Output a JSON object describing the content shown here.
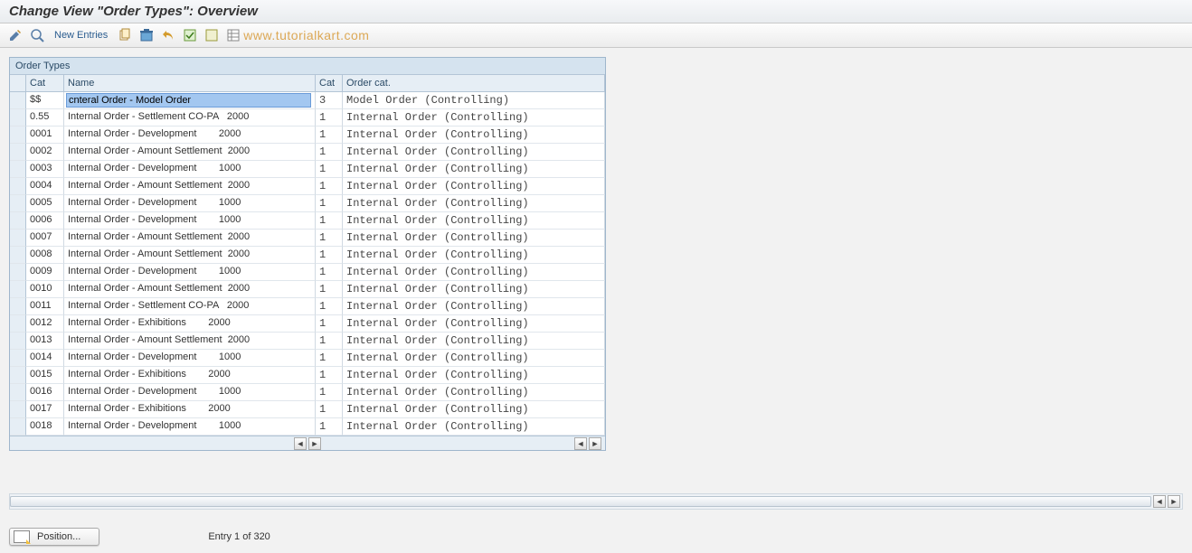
{
  "title": "Change View \"Order Types\": Overview",
  "toolbar": {
    "new_entries": "New Entries"
  },
  "watermark": "www.tutorialkart.com",
  "panel": {
    "title": "Order Types",
    "columns": {
      "selector": "",
      "cat1": "Cat",
      "name": "Name",
      "cat2": "Cat",
      "order_cat": "Order cat."
    }
  },
  "selected_name_value": "cnteral Order - Model Order",
  "rows": [
    {
      "cat1": "$$",
      "name": "cnteral Order - Model Order",
      "cat2": "3",
      "order_cat": "Model Order (Controlling)",
      "selected": true
    },
    {
      "cat1": "0.55",
      "name": "Internal Order - Settlement CO-PA   2000",
      "cat2": "1",
      "order_cat": "Internal Order (Controlling)"
    },
    {
      "cat1": "0001",
      "name": "Internal Order - Development        2000",
      "cat2": "1",
      "order_cat": "Internal Order (Controlling)"
    },
    {
      "cat1": "0002",
      "name": "Internal Order - Amount Settlement  2000",
      "cat2": "1",
      "order_cat": "Internal Order (Controlling)"
    },
    {
      "cat1": "0003",
      "name": "Internal Order - Development        1000",
      "cat2": "1",
      "order_cat": "Internal Order (Controlling)"
    },
    {
      "cat1": "0004",
      "name": "Internal Order - Amount Settlement  2000",
      "cat2": "1",
      "order_cat": "Internal Order (Controlling)"
    },
    {
      "cat1": "0005",
      "name": "Internal Order - Development        1000",
      "cat2": "1",
      "order_cat": "Internal Order (Controlling)"
    },
    {
      "cat1": "0006",
      "name": "Internal Order - Development        1000",
      "cat2": "1",
      "order_cat": "Internal Order (Controlling)"
    },
    {
      "cat1": "0007",
      "name": "Internal Order - Amount Settlement  2000",
      "cat2": "1",
      "order_cat": "Internal Order (Controlling)"
    },
    {
      "cat1": "0008",
      "name": "Internal Order - Amount Settlement  2000",
      "cat2": "1",
      "order_cat": "Internal Order (Controlling)"
    },
    {
      "cat1": "0009",
      "name": "Internal Order - Development        1000",
      "cat2": "1",
      "order_cat": "Internal Order (Controlling)"
    },
    {
      "cat1": "0010",
      "name": "Internal Order - Amount Settlement  2000",
      "cat2": "1",
      "order_cat": "Internal Order (Controlling)"
    },
    {
      "cat1": "0011",
      "name": "Internal Order - Settlement CO-PA   2000",
      "cat2": "1",
      "order_cat": "Internal Order (Controlling)"
    },
    {
      "cat1": "0012",
      "name": "Internal Order - Exhibitions        2000",
      "cat2": "1",
      "order_cat": "Internal Order (Controlling)"
    },
    {
      "cat1": "0013",
      "name": "Internal Order - Amount Settlement  2000",
      "cat2": "1",
      "order_cat": "Internal Order (Controlling)"
    },
    {
      "cat1": "0014",
      "name": "Internal Order - Development        1000",
      "cat2": "1",
      "order_cat": "Internal Order (Controlling)"
    },
    {
      "cat1": "0015",
      "name": "Internal Order - Exhibitions        2000",
      "cat2": "1",
      "order_cat": "Internal Order (Controlling)"
    },
    {
      "cat1": "0016",
      "name": "Internal Order - Development        1000",
      "cat2": "1",
      "order_cat": "Internal Order (Controlling)"
    },
    {
      "cat1": "0017",
      "name": "Internal Order - Exhibitions        2000",
      "cat2": "1",
      "order_cat": "Internal Order (Controlling)"
    },
    {
      "cat1": "0018",
      "name": "Internal Order - Development        1000",
      "cat2": "1",
      "order_cat": "Internal Order (Controlling)"
    }
  ],
  "footer": {
    "position_label": "Position...",
    "entry_info": "Entry 1 of 320"
  }
}
